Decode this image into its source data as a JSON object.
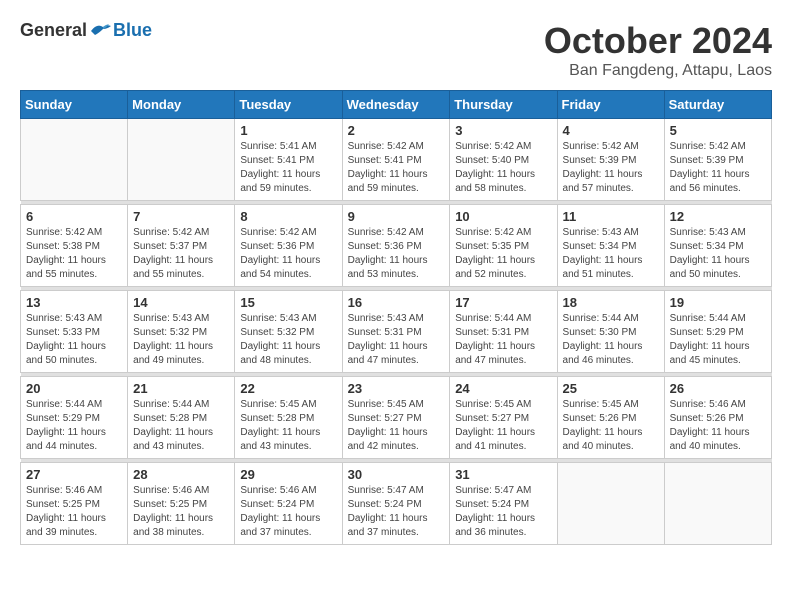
{
  "header": {
    "logo_general": "General",
    "logo_blue": "Blue",
    "month_title": "October 2024",
    "location": "Ban Fangdeng, Attapu, Laos"
  },
  "weekdays": [
    "Sunday",
    "Monday",
    "Tuesday",
    "Wednesday",
    "Thursday",
    "Friday",
    "Saturday"
  ],
  "weeks": [
    [
      {
        "day": "",
        "info": ""
      },
      {
        "day": "",
        "info": ""
      },
      {
        "day": "1",
        "info": "Sunrise: 5:41 AM\nSunset: 5:41 PM\nDaylight: 11 hours and 59 minutes."
      },
      {
        "day": "2",
        "info": "Sunrise: 5:42 AM\nSunset: 5:41 PM\nDaylight: 11 hours and 59 minutes."
      },
      {
        "day": "3",
        "info": "Sunrise: 5:42 AM\nSunset: 5:40 PM\nDaylight: 11 hours and 58 minutes."
      },
      {
        "day": "4",
        "info": "Sunrise: 5:42 AM\nSunset: 5:39 PM\nDaylight: 11 hours and 57 minutes."
      },
      {
        "day": "5",
        "info": "Sunrise: 5:42 AM\nSunset: 5:39 PM\nDaylight: 11 hours and 56 minutes."
      }
    ],
    [
      {
        "day": "6",
        "info": "Sunrise: 5:42 AM\nSunset: 5:38 PM\nDaylight: 11 hours and 55 minutes."
      },
      {
        "day": "7",
        "info": "Sunrise: 5:42 AM\nSunset: 5:37 PM\nDaylight: 11 hours and 55 minutes."
      },
      {
        "day": "8",
        "info": "Sunrise: 5:42 AM\nSunset: 5:36 PM\nDaylight: 11 hours and 54 minutes."
      },
      {
        "day": "9",
        "info": "Sunrise: 5:42 AM\nSunset: 5:36 PM\nDaylight: 11 hours and 53 minutes."
      },
      {
        "day": "10",
        "info": "Sunrise: 5:42 AM\nSunset: 5:35 PM\nDaylight: 11 hours and 52 minutes."
      },
      {
        "day": "11",
        "info": "Sunrise: 5:43 AM\nSunset: 5:34 PM\nDaylight: 11 hours and 51 minutes."
      },
      {
        "day": "12",
        "info": "Sunrise: 5:43 AM\nSunset: 5:34 PM\nDaylight: 11 hours and 50 minutes."
      }
    ],
    [
      {
        "day": "13",
        "info": "Sunrise: 5:43 AM\nSunset: 5:33 PM\nDaylight: 11 hours and 50 minutes."
      },
      {
        "day": "14",
        "info": "Sunrise: 5:43 AM\nSunset: 5:32 PM\nDaylight: 11 hours and 49 minutes."
      },
      {
        "day": "15",
        "info": "Sunrise: 5:43 AM\nSunset: 5:32 PM\nDaylight: 11 hours and 48 minutes."
      },
      {
        "day": "16",
        "info": "Sunrise: 5:43 AM\nSunset: 5:31 PM\nDaylight: 11 hours and 47 minutes."
      },
      {
        "day": "17",
        "info": "Sunrise: 5:44 AM\nSunset: 5:31 PM\nDaylight: 11 hours and 47 minutes."
      },
      {
        "day": "18",
        "info": "Sunrise: 5:44 AM\nSunset: 5:30 PM\nDaylight: 11 hours and 46 minutes."
      },
      {
        "day": "19",
        "info": "Sunrise: 5:44 AM\nSunset: 5:29 PM\nDaylight: 11 hours and 45 minutes."
      }
    ],
    [
      {
        "day": "20",
        "info": "Sunrise: 5:44 AM\nSunset: 5:29 PM\nDaylight: 11 hours and 44 minutes."
      },
      {
        "day": "21",
        "info": "Sunrise: 5:44 AM\nSunset: 5:28 PM\nDaylight: 11 hours and 43 minutes."
      },
      {
        "day": "22",
        "info": "Sunrise: 5:45 AM\nSunset: 5:28 PM\nDaylight: 11 hours and 43 minutes."
      },
      {
        "day": "23",
        "info": "Sunrise: 5:45 AM\nSunset: 5:27 PM\nDaylight: 11 hours and 42 minutes."
      },
      {
        "day": "24",
        "info": "Sunrise: 5:45 AM\nSunset: 5:27 PM\nDaylight: 11 hours and 41 minutes."
      },
      {
        "day": "25",
        "info": "Sunrise: 5:45 AM\nSunset: 5:26 PM\nDaylight: 11 hours and 40 minutes."
      },
      {
        "day": "26",
        "info": "Sunrise: 5:46 AM\nSunset: 5:26 PM\nDaylight: 11 hours and 40 minutes."
      }
    ],
    [
      {
        "day": "27",
        "info": "Sunrise: 5:46 AM\nSunset: 5:25 PM\nDaylight: 11 hours and 39 minutes."
      },
      {
        "day": "28",
        "info": "Sunrise: 5:46 AM\nSunset: 5:25 PM\nDaylight: 11 hours and 38 minutes."
      },
      {
        "day": "29",
        "info": "Sunrise: 5:46 AM\nSunset: 5:24 PM\nDaylight: 11 hours and 37 minutes."
      },
      {
        "day": "30",
        "info": "Sunrise: 5:47 AM\nSunset: 5:24 PM\nDaylight: 11 hours and 37 minutes."
      },
      {
        "day": "31",
        "info": "Sunrise: 5:47 AM\nSunset: 5:24 PM\nDaylight: 11 hours and 36 minutes."
      },
      {
        "day": "",
        "info": ""
      },
      {
        "day": "",
        "info": ""
      }
    ]
  ]
}
